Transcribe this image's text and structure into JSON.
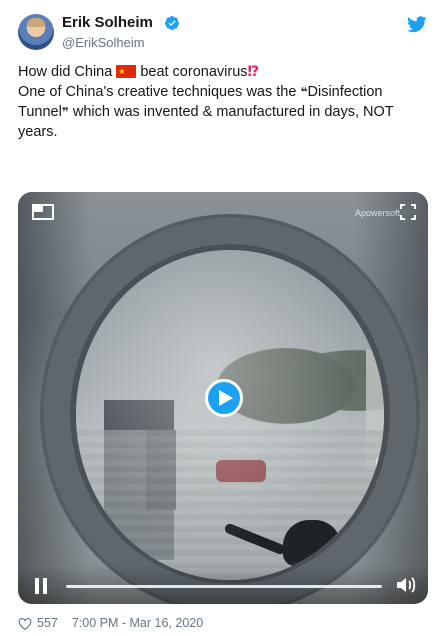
{
  "author": {
    "name": "Erik Solheim",
    "handle": "@ErikSolheim",
    "verified": true,
    "avatar_icon": "profile-photo"
  },
  "tweet": {
    "line1_before_flag": "How did China",
    "flag_icon": "china-flag-emoji",
    "line1_after_flag": "beat coronavirus",
    "interrobang": "⁉",
    "line2_before_quote": "One of China's creative techniques was the ",
    "open_quote": "❝",
    "quoted": "Disinfection Tunnel",
    "close_quote": "❞",
    "line2_after_quote": " which was invented & manufactured in days, NOT years."
  },
  "video": {
    "watermark": "Apowersoft",
    "state": "paused-preview",
    "progress": 0.0,
    "accent_color": "#1da1f2"
  },
  "footer": {
    "likes": "557",
    "timestamp": "7:00 PM - Mar 16, 2020"
  },
  "colors": {
    "brand": "#1da1f2",
    "text": "#14171a",
    "secondary": "#657786"
  }
}
